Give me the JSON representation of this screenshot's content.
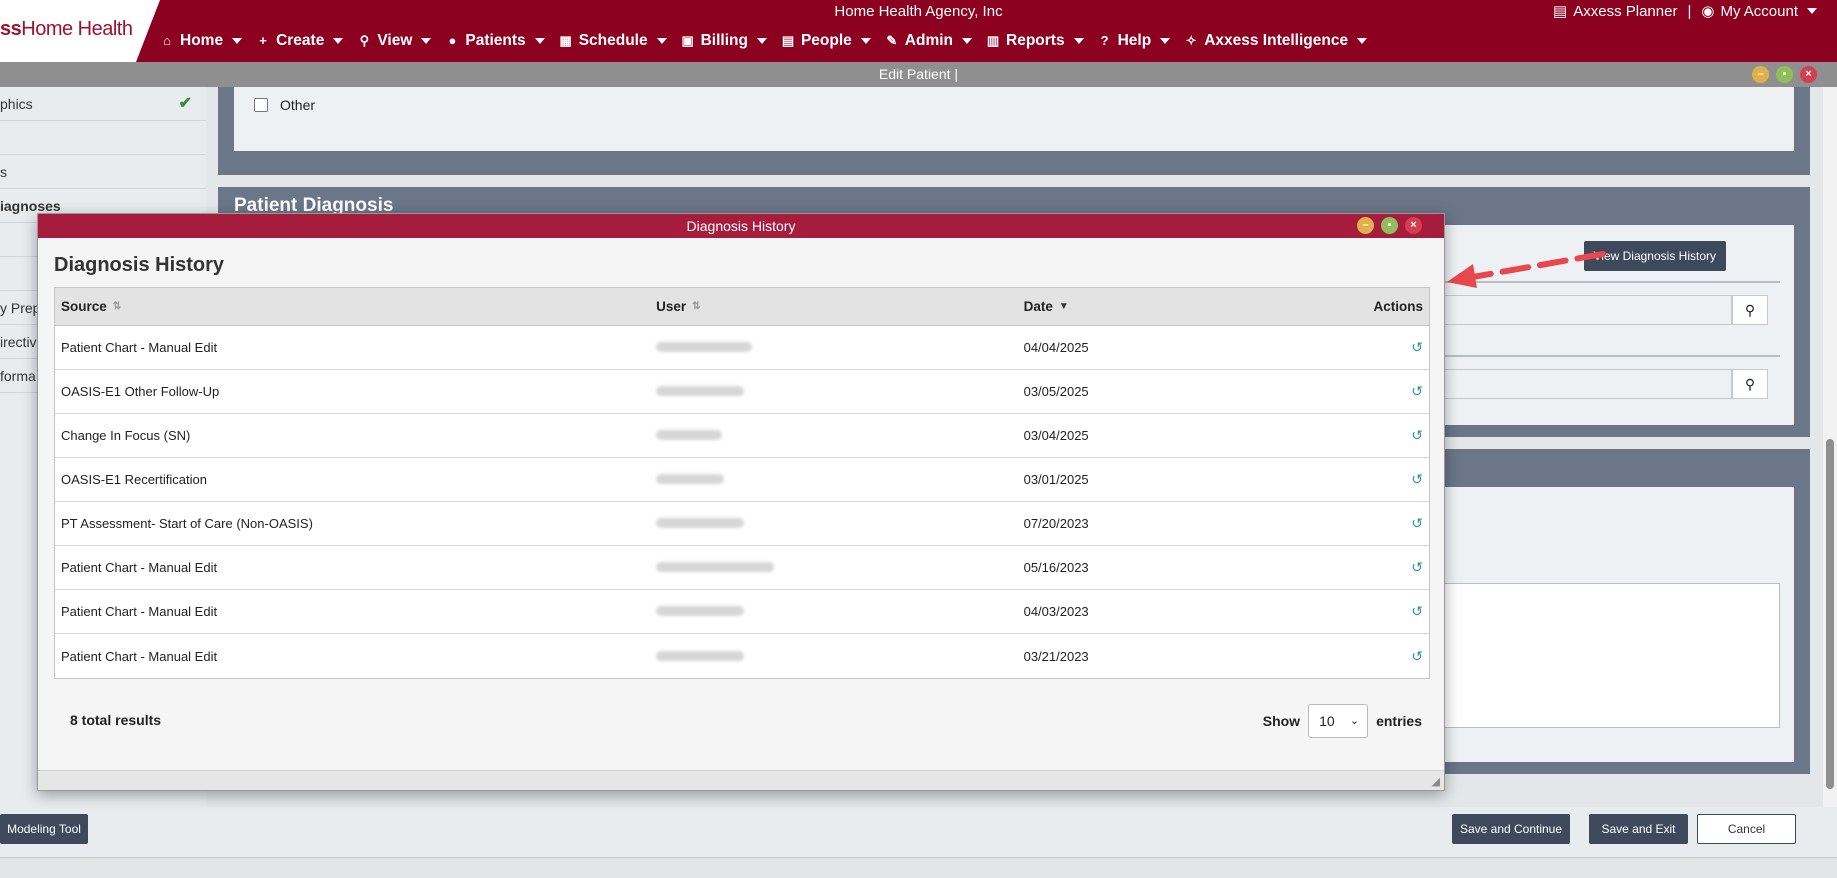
{
  "header": {
    "logo_text": "Home Health",
    "logo_prefix": "ss",
    "agency": "Home Health Agency, Inc",
    "planner": "Axxess Planner",
    "separator": "|",
    "account": "My Account"
  },
  "nav": [
    {
      "label": "Home",
      "icon": "home-icon",
      "glyph": "⌂"
    },
    {
      "label": "Create",
      "icon": "plus-icon",
      "glyph": "+"
    },
    {
      "label": "View",
      "icon": "search-icon",
      "glyph": "⚲"
    },
    {
      "label": "Patients",
      "icon": "person-icon",
      "glyph": "●"
    },
    {
      "label": "Schedule",
      "icon": "calendar-icon",
      "glyph": "▦"
    },
    {
      "label": "Billing",
      "icon": "money-icon",
      "glyph": "▣"
    },
    {
      "label": "People",
      "icon": "id-card-icon",
      "glyph": "▤"
    },
    {
      "label": "Admin",
      "icon": "wrench-icon",
      "glyph": "✎"
    },
    {
      "label": "Reports",
      "icon": "chart-icon",
      "glyph": "▥"
    },
    {
      "label": "Help",
      "icon": "question-icon",
      "glyph": "?"
    },
    {
      "label": "Axxess Intelligence",
      "icon": "intelligence-icon",
      "glyph": "✧"
    }
  ],
  "window": {
    "title": "Edit Patient |"
  },
  "sidebar": {
    "items": [
      {
        "label": "phics",
        "active": false,
        "checked": true
      },
      {
        "label": "",
        "active": false,
        "checked": false
      },
      {
        "label": "s",
        "active": false,
        "checked": false
      },
      {
        "label": "iagnoses",
        "active": true,
        "checked": false
      },
      {
        "label": "",
        "active": false,
        "checked": false
      },
      {
        "label": "",
        "active": false,
        "checked": false
      },
      {
        "label": "y Prep",
        "active": false,
        "checked": false
      },
      {
        "label": "irectiv",
        "active": false,
        "checked": false
      },
      {
        "label": "forma",
        "active": false,
        "checked": false
      }
    ]
  },
  "main": {
    "other_label": "Other",
    "diag_title": "Patient Diagnosis",
    "view_history_btn": "View Diagnosis History"
  },
  "footer": {
    "modeling_tool": "Modeling Tool",
    "save_continue": "Save and Continue",
    "save_exit": "Save and Exit",
    "cancel": "Cancel"
  },
  "modal": {
    "bar_title": "Diagnosis History",
    "title": "Diagnosis History",
    "columns": {
      "source": "Source",
      "user": "User",
      "date": "Date",
      "actions": "Actions"
    },
    "rows": [
      {
        "source": "Patient Chart - Manual Edit",
        "date": "04/04/2025"
      },
      {
        "source": "OASIS-E1 Other Follow-Up",
        "date": "03/05/2025"
      },
      {
        "source": "Change In Focus (SN)",
        "date": "03/04/2025"
      },
      {
        "source": "OASIS-E1 Recertification",
        "date": "03/01/2025"
      },
      {
        "source": "PT Assessment- Start of Care (Non-OASIS)",
        "date": "07/20/2023"
      },
      {
        "source": "Patient Chart - Manual Edit",
        "date": "05/16/2023"
      },
      {
        "source": "Patient Chart - Manual Edit",
        "date": "04/03/2023"
      },
      {
        "source": "Patient Chart - Manual Edit",
        "date": "03/21/2023"
      }
    ],
    "total": "8 total results",
    "show": "Show",
    "page_size": "10",
    "entries": "entries"
  },
  "colors": {
    "brand": "#8c0020",
    "modal_bar": "#a61c3c",
    "button_dark": "#3e4a5c",
    "arrow": "#e8474d",
    "history_icon": "#2f8fb5"
  }
}
